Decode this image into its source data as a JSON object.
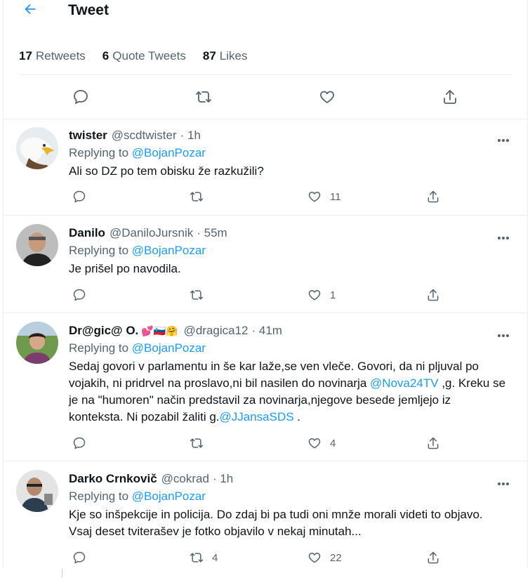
{
  "header": {
    "title": "Tweet"
  },
  "stats": [
    {
      "num": "17",
      "label": "Retweets"
    },
    {
      "num": "6",
      "label": "Quote Tweets"
    },
    {
      "num": "87",
      "label": "Likes"
    }
  ],
  "replies": [
    {
      "name": "twister",
      "handle": "@scdtwister",
      "time": "· 1h",
      "replying_prefix": "Replying to",
      "replying_to": "@BojanPozar",
      "text": "Ali so DZ po tem obisku že razkužili?",
      "like_count": "11",
      "retweet_count": ""
    },
    {
      "name": "Danilo",
      "handle": "@DaniloJursnik",
      "time": "· 55m",
      "replying_prefix": "Replying to",
      "replying_to": "@BojanPozar",
      "text": "Je prišel po navodila.",
      "like_count": "1",
      "retweet_count": ""
    },
    {
      "name": "Dr@gic@ O.",
      "emojis": "💕🇸🇮🤗",
      "handle": "@dragica12",
      "time": "· 41m",
      "replying_prefix": "Replying to",
      "replying_to": "@BojanPozar",
      "text_a": "Sedaj govori v parlamentu in še kar laže,se ven vleče. Govori, da ni pljuval po vojakih, ni pridrvel na proslavo,ni bil nasilen do novinarja ",
      "mention_a": "@Nova24TV",
      "text_b": " ,g. Kreku se je na \"humoren\" način predstavil za novinarja,njegove besede jemljejo iz konteksta. Ni pozabil žaliti g.",
      "mention_b": "@JJansaSDS",
      "text_c": " .",
      "like_count": "4",
      "retweet_count": ""
    },
    {
      "name": "Darko Crnkovič",
      "handle": "@cokrad",
      "time": "· 1h",
      "replying_prefix": "Replying to",
      "replying_to": "@BojanPozar",
      "text": "Kje so inšpekcije in policija. Do zdaj bi pa tudi oni mnže morali videti to objavo. Vsaj deset tviterašev je fotko objavilo v nekaj minutah...",
      "like_count": "22",
      "retweet_count": "4"
    }
  ],
  "colors": {
    "accent": "#1d9bf0",
    "secondary_text": "#536471",
    "border": "#ebeef0"
  }
}
